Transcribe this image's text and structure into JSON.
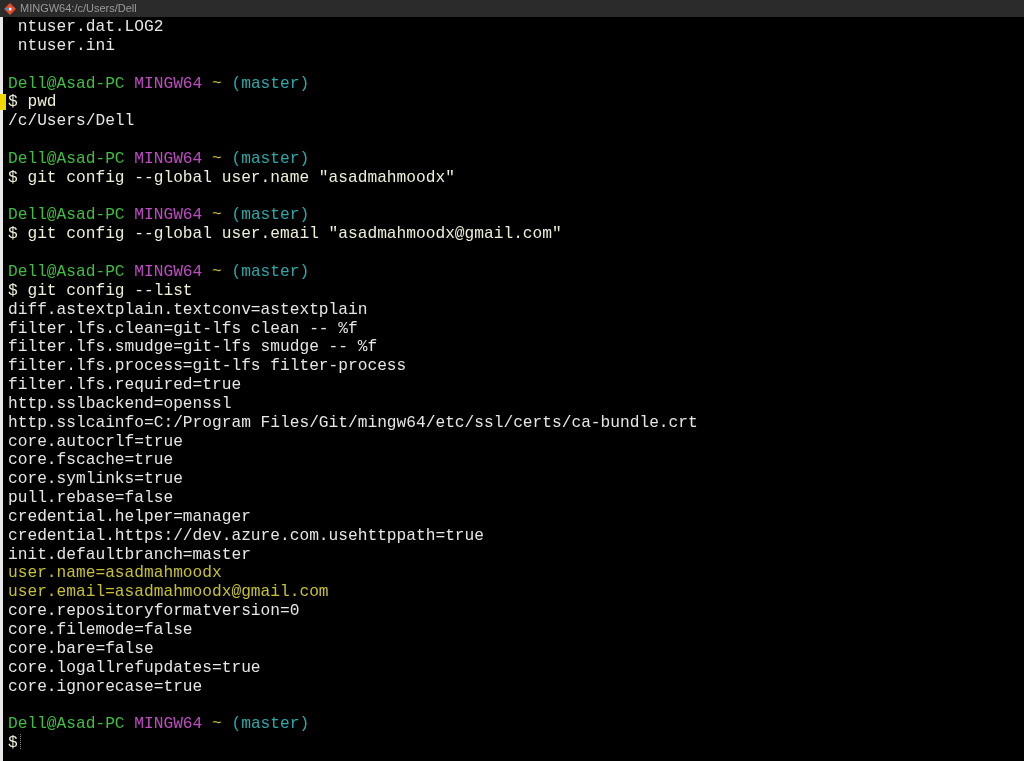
{
  "window": {
    "title": "MINGW64:/c/Users/Dell"
  },
  "lines": [
    {
      "kind": "output",
      "text": " ntuser.dat.LOG2"
    },
    {
      "kind": "output",
      "text": " ntuser.ini"
    },
    {
      "kind": "blank"
    },
    {
      "kind": "prompt",
      "user_host": "Dell@Asad-PC",
      "system": "MINGW64",
      "dir": "~",
      "branch": "(master)"
    },
    {
      "kind": "command",
      "symbol": "$",
      "text": "pwd",
      "marked": true,
      "cursor": false
    },
    {
      "kind": "output",
      "text": "/c/Users/Dell"
    },
    {
      "kind": "blank"
    },
    {
      "kind": "prompt",
      "user_host": "Dell@Asad-PC",
      "system": "MINGW64",
      "dir": "~",
      "branch": "(master)"
    },
    {
      "kind": "command",
      "symbol": "$",
      "text": "git config --global user.name \"asadmahmoodx\"",
      "marked": false,
      "cursor": false
    },
    {
      "kind": "blank"
    },
    {
      "kind": "prompt",
      "user_host": "Dell@Asad-PC",
      "system": "MINGW64",
      "dir": "~",
      "branch": "(master)"
    },
    {
      "kind": "command",
      "symbol": "$",
      "text": "git config --global user.email \"asadmahmoodx@gmail.com\"",
      "marked": false,
      "cursor": false
    },
    {
      "kind": "blank"
    },
    {
      "kind": "prompt",
      "user_host": "Dell@Asad-PC",
      "system": "MINGW64",
      "dir": "~",
      "branch": "(master)"
    },
    {
      "kind": "command",
      "symbol": "$",
      "text": "git config --list",
      "marked": false,
      "cursor": false
    },
    {
      "kind": "output",
      "text": "diff.astextplain.textconv=astextplain"
    },
    {
      "kind": "output",
      "text": "filter.lfs.clean=git-lfs clean -- %f"
    },
    {
      "kind": "output",
      "text": "filter.lfs.smudge=git-lfs smudge -- %f"
    },
    {
      "kind": "output",
      "text": "filter.lfs.process=git-lfs filter-process"
    },
    {
      "kind": "output",
      "text": "filter.lfs.required=true"
    },
    {
      "kind": "output",
      "text": "http.sslbackend=openssl"
    },
    {
      "kind": "output",
      "text": "http.sslcainfo=C:/Program Files/Git/mingw64/etc/ssl/certs/ca-bundle.crt"
    },
    {
      "kind": "output",
      "text": "core.autocrlf=true"
    },
    {
      "kind": "output",
      "text": "core.fscache=true"
    },
    {
      "kind": "output",
      "text": "core.symlinks=true"
    },
    {
      "kind": "output",
      "text": "pull.rebase=false"
    },
    {
      "kind": "output",
      "text": "credential.helper=manager"
    },
    {
      "kind": "output",
      "text": "credential.https://dev.azure.com.usehttppath=true"
    },
    {
      "kind": "output",
      "text": "init.defaultbranch=master"
    },
    {
      "kind": "highlighted-output",
      "text": "user.name=asadmahmoodx"
    },
    {
      "kind": "highlighted-output",
      "text": "user.email=asadmahmoodx@gmail.com"
    },
    {
      "kind": "output",
      "text": "core.repositoryformatversion=0"
    },
    {
      "kind": "output",
      "text": "core.filemode=false"
    },
    {
      "kind": "output",
      "text": "core.bare=false"
    },
    {
      "kind": "output",
      "text": "core.logallrefupdates=true"
    },
    {
      "kind": "output",
      "text": "core.ignorecase=true"
    },
    {
      "kind": "blank"
    },
    {
      "kind": "prompt",
      "user_host": "Dell@Asad-PC",
      "system": "MINGW64",
      "dir": "~",
      "branch": "(master)"
    },
    {
      "kind": "command",
      "symbol": "$",
      "marked": false,
      "cursor": true
    }
  ]
}
